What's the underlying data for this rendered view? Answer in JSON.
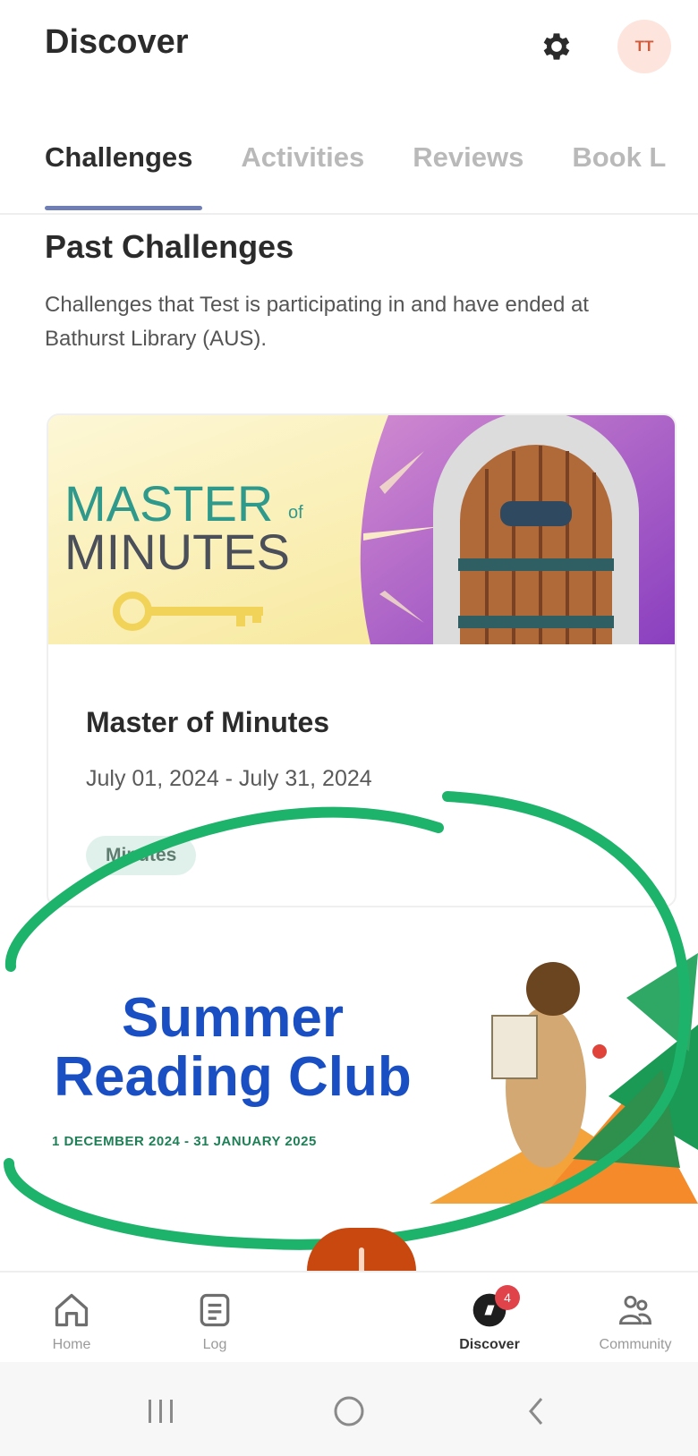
{
  "header": {
    "title": "Discover",
    "avatar_initials": "TT"
  },
  "tabs": [
    {
      "label": "Challenges",
      "active": true
    },
    {
      "label": "Activities",
      "active": false
    },
    {
      "label": "Reviews",
      "active": false
    },
    {
      "label": "Book L",
      "active": false
    }
  ],
  "section": {
    "title": "Past Challenges",
    "description": "Challenges that Test is participating in and have ended at Bathurst Library (AUS)."
  },
  "challenges": [
    {
      "banner_line1": "MASTER",
      "banner_of": "of",
      "banner_line2": "MINUTES",
      "title": "Master of Minutes",
      "dates": "July 01, 2024 - July 31, 2024",
      "tag": "Minutes"
    },
    {
      "banner_line1": "Summer",
      "banner_line2": "Reading Club",
      "banner_dates": "1 DECEMBER 2024 - 31 JANUARY 2025"
    }
  ],
  "bottom_nav": [
    {
      "label": "Home",
      "icon": "home-icon"
    },
    {
      "label": "Log",
      "icon": "log-icon"
    },
    {
      "label": "Discover",
      "icon": "discover-icon",
      "badge": "4",
      "active": true
    },
    {
      "label": "Community",
      "icon": "community-icon"
    }
  ],
  "system_nav": [
    "recents-icon",
    "home-circle-icon",
    "back-icon"
  ],
  "colors": {
    "accent": "#6f7fb6",
    "fab": "#c9480f",
    "annotation": "#1db36b"
  }
}
